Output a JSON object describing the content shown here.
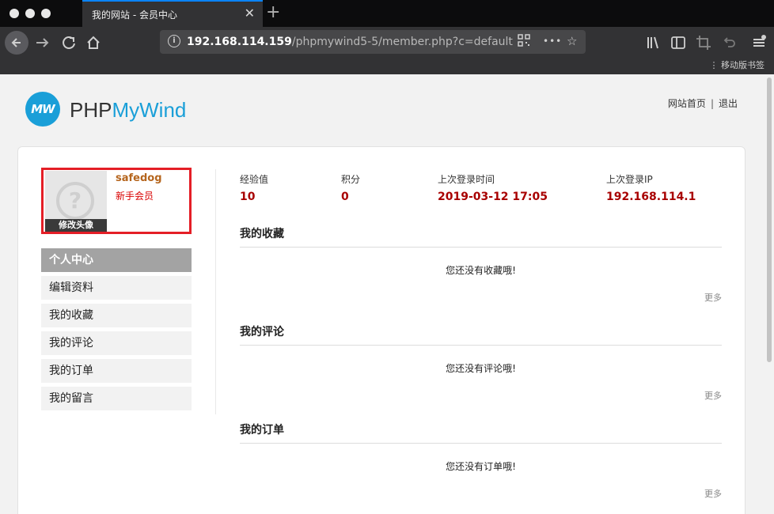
{
  "browser": {
    "tab_title": "我的网站 - 会员中心",
    "tab_close": "✕",
    "new_tab": "+",
    "url_host": "192.168.114.159",
    "url_path": "/phpmywind5-5/member.php?c=default",
    "mobile_bookmarks": "移动版书签",
    "url_more": "•••"
  },
  "header": {
    "logo_mark": "MW",
    "logo_text_php": "PHP",
    "logo_text_mywind": "MyWind",
    "link_home": "网站首页",
    "link_separator": "|",
    "link_logout": "退出"
  },
  "profile": {
    "username": "safedog",
    "level": "新手会员",
    "edit_avatar": "修改头像",
    "avatar_glyph": "?"
  },
  "menu": {
    "items": [
      {
        "label": "个人中心"
      },
      {
        "label": "编辑资料"
      },
      {
        "label": "我的收藏"
      },
      {
        "label": "我的评论"
      },
      {
        "label": "我的订单"
      },
      {
        "label": "我的留言"
      }
    ]
  },
  "stats": [
    {
      "label": "经验值",
      "value": "10"
    },
    {
      "label": "积分",
      "value": "0"
    },
    {
      "label": "上次登录时间",
      "value": "2019-03-12 17:05"
    },
    {
      "label": "上次登录IP",
      "value": "192.168.114.1"
    }
  ],
  "sections": [
    {
      "title": "我的收藏",
      "empty": "您还没有收藏哦!",
      "more": "更多"
    },
    {
      "title": "我的评论",
      "empty": "您还没有评论哦!",
      "more": "更多"
    },
    {
      "title": "我的订单",
      "empty": "您还没有订单哦!",
      "more": "更多"
    }
  ]
}
